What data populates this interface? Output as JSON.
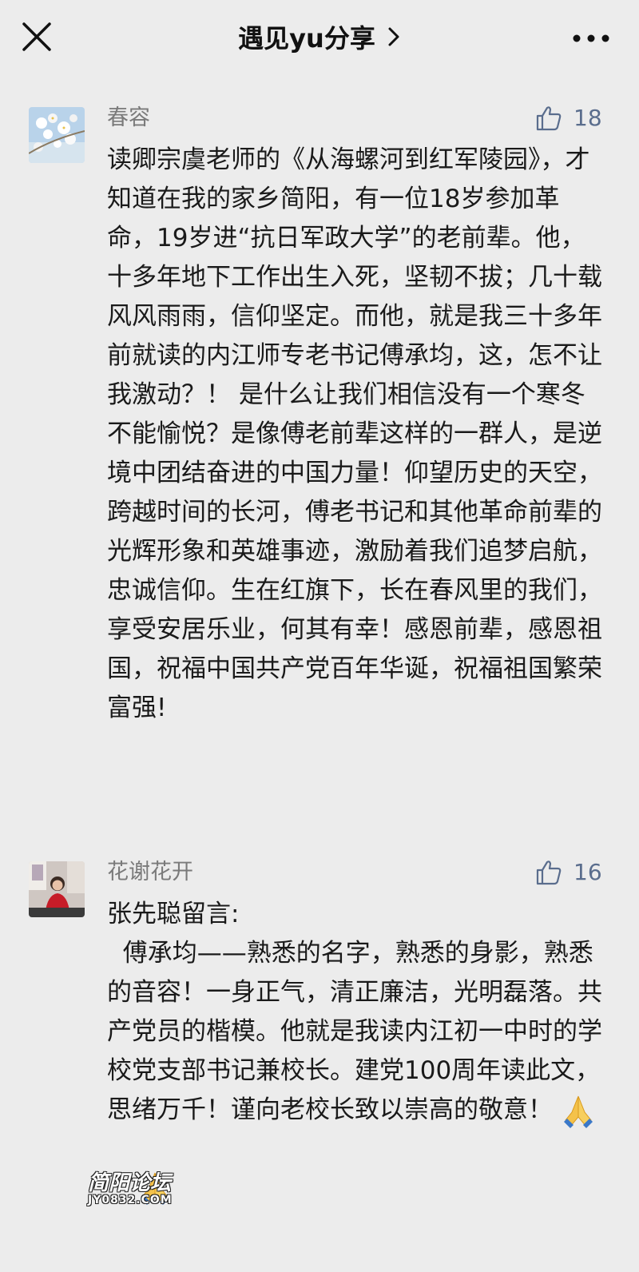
{
  "header": {
    "title": "遇见yu分享",
    "close_icon": "close-icon",
    "more_icon": "more-dots-icon",
    "chevron_icon": "chevron-right-icon"
  },
  "comments": [
    {
      "author": "春容",
      "likes": "18",
      "text": "读卿宗虞老师的《从海螺河到红军陵园》，才知道在我的家乡简阳，有一位18岁参加革命，19岁进“抗日军政大学”的老前辈。他，十多年地下工作出生入死，坚韧不拔；几十载风风雨雨，信仰坚定。而他，就是我三十多年前就读的内江师专老书记傅承均，这，怎不让我激动？！ 是什么让我们相信没有一个寒冬不能愉悦？是像傅老前辈这样的一群人，是逆境中团结奋进的中国力量！仰望历史的天空，跨越时间的长河，傅老书记和其他革命前辈的光辉形象和英雄事迹，激励着我们追梦启航，忠诚信仰。生在红旗下，长在春风里的我们，享受安居乐业，何其有幸！感恩前辈，感恩祖国，祝福中国共产党百年华诞，祝福祖国繁荣富强!"
    },
    {
      "author": "花谢花开",
      "likes": "16",
      "text": "张先聪留言:\n  傅承均——熟悉的名字，熟悉的身影，熟悉的音容！一身正气，清正廉洁，光明磊落。共产党员的楷模。他就是我读内江初一中时的学校党支部书记兼校长。建党100周年读此文，思绪万千！谨向老校长致以崇高的敬意！"
    }
  ],
  "watermark": {
    "cn": "简阳论坛",
    "en": "JY0832.COM"
  },
  "colors": {
    "background": "#ececec",
    "author": "#7a7a7a",
    "like": "#5a6d8d",
    "text": "#1a1a1a"
  }
}
